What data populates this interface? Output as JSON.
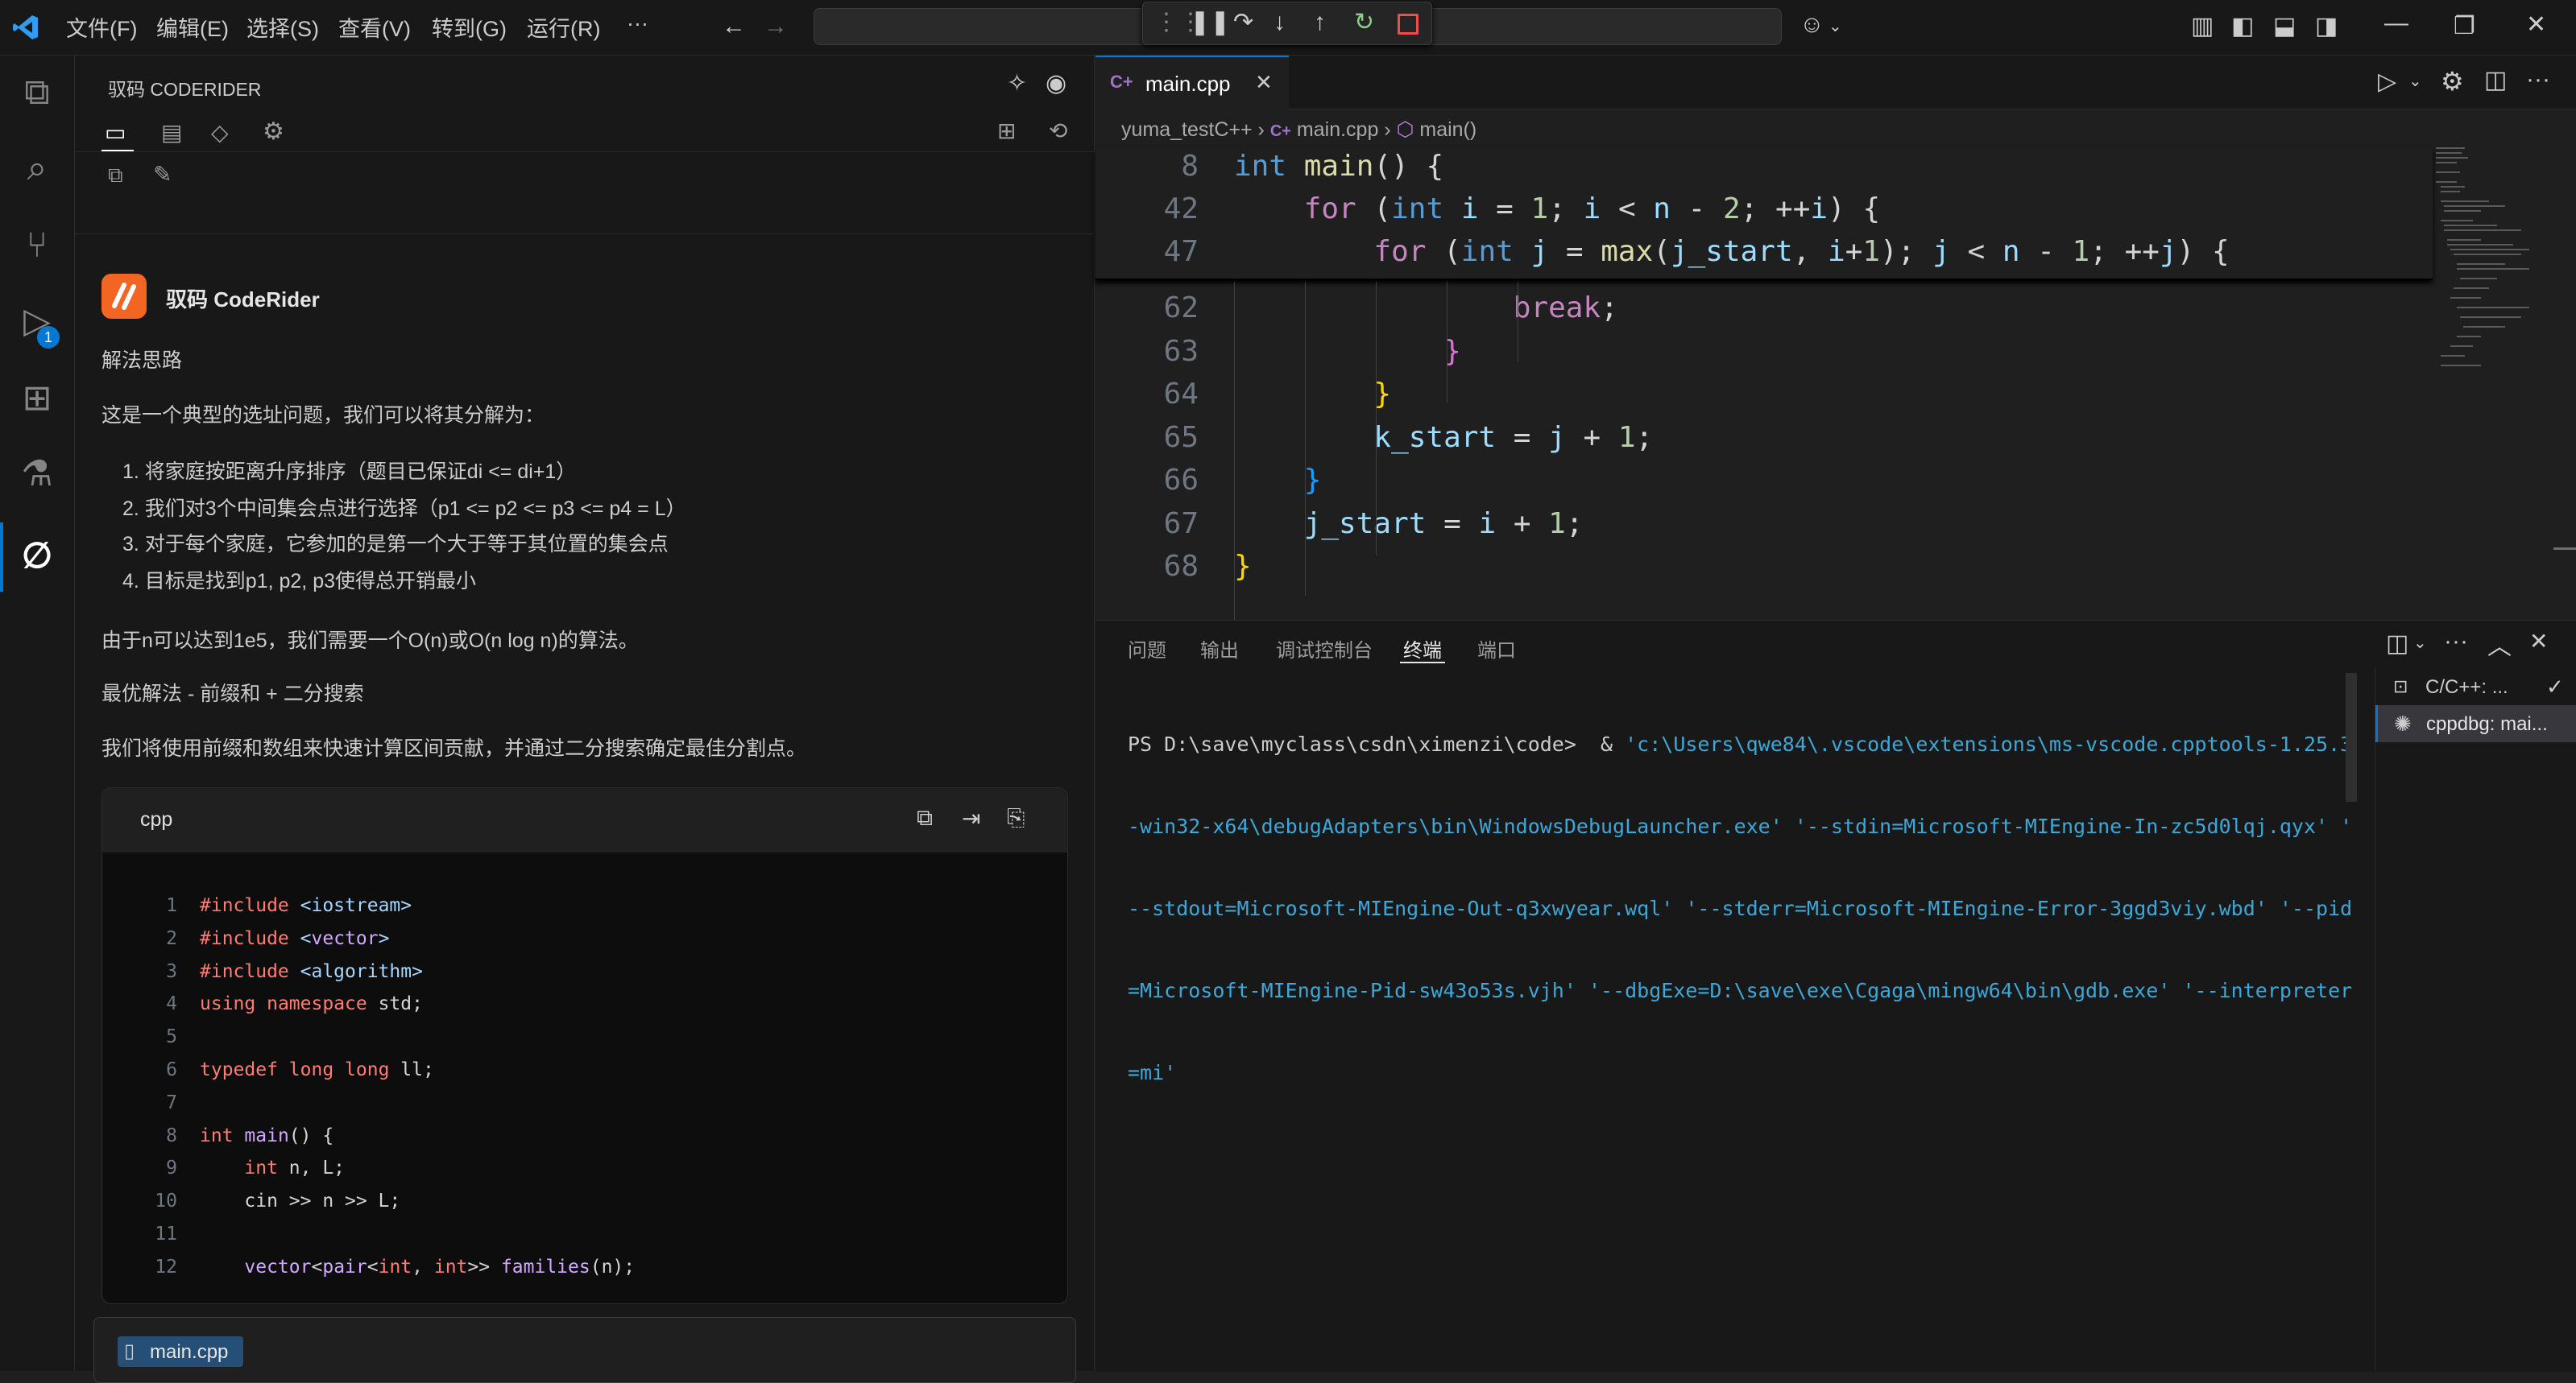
{
  "menu": [
    "文件(F)",
    "编辑(E)",
    "选择(S)",
    "查看(V)",
    "转到(G)",
    "运行(R)",
    "···"
  ],
  "activity": {
    "debug_badge": "1"
  },
  "sidebar": {
    "title": "驭码 CODERIDER",
    "bot_name": "驭码 CodeRider",
    "heading1": "解法思路",
    "intro": "这是一个典型的选址问题，我们可以将其分解为：",
    "steps": [
      "1. 将家庭按距离升序排序（题目已保证di <= di+1）",
      "2. 我们对3个中间集会点进行选择（p1 <= p2 <= p3 <= p4 = L）",
      "3. 对于每个家庭，它参加的是第一个大于等于其位置的集会点",
      "4. 目标是找到p1, p2, p3使得总开销最小"
    ],
    "note": "由于n可以达到1e5，我们需要一个O(n)或O(n log n)的算法。",
    "heading2": "最优解法 - 前缀和 + 二分搜索",
    "desc": "我们将使用前缀和数组来快速计算区间贡献，并通过二分搜索确定最佳分割点。",
    "code_lang": "cpp",
    "code_lines": [
      {
        "n": "1",
        "t": "#include <iostream>"
      },
      {
        "n": "2",
        "t": "#include <vector>"
      },
      {
        "n": "3",
        "t": "#include <algorithm>"
      },
      {
        "n": "4",
        "t": "using namespace std;"
      },
      {
        "n": "5",
        "t": ""
      },
      {
        "n": "6",
        "t": "typedef long long ll;"
      },
      {
        "n": "7",
        "t": ""
      },
      {
        "n": "8",
        "t": "int main() {"
      },
      {
        "n": "9",
        "t": "    int n, L;"
      },
      {
        "n": "10",
        "t": "    cin >> n >> L;"
      },
      {
        "n": "11",
        "t": ""
      },
      {
        "n": "12",
        "t": "    vector<pair<int, int>> families(n);"
      }
    ],
    "attached_file": "main.cpp"
  },
  "editor": {
    "tab": "main.cpp",
    "breadcrumb": [
      "yuma_testC++",
      "main.cpp",
      "main()"
    ],
    "sticky_lines": [
      {
        "n": "8",
        "t": "int main() {"
      },
      {
        "n": "42",
        "t": "    for (int i = 1; i < n - 2; ++i) {"
      },
      {
        "n": "47",
        "t": "        for (int j = max(j_start, i+1); j < n - 1; ++j) {"
      }
    ],
    "lines": [
      {
        "n": "62",
        "t": "                break;"
      },
      {
        "n": "63",
        "t": "            }"
      },
      {
        "n": "64",
        "t": "        }"
      },
      {
        "n": "65",
        "t": "        k_start = j + 1;"
      },
      {
        "n": "66",
        "t": "    }"
      },
      {
        "n": "67",
        "t": "    j_start = i + 1;"
      },
      {
        "n": "68",
        "t": "}"
      }
    ]
  },
  "panel": {
    "tabs": [
      "问题",
      "输出",
      "调试控制台",
      "终端",
      "端口"
    ],
    "active_tab": "终端",
    "terminal_prompt": "PS D:\\save\\myclass\\csdn\\ximenzi\\code>  & ",
    "terminal_lines": [
      "'c:\\Users\\qwe84\\.vscode\\extensions\\ms-vscode.cpptools-1.25.3",
      "-win32-x64\\debugAdapters\\bin\\WindowsDebugLauncher.exe' '--stdin=Microsoft-MIEngine-In-zc5d0lqj.qyx' '",
      "--stdout=Microsoft-MIEngine-Out-q3xwyear.wql' '--stderr=Microsoft-MIEngine-Error-3ggd3viy.wbd' '--pid",
      "=Microsoft-MIEngine-Pid-sw43o53s.vjh' '--dbgExe=D:\\save\\exe\\Cgaga\\mingw64\\bin\\gdb.exe' '--interpreter",
      "=mi'"
    ],
    "terminal_list": [
      "C/C++: ...",
      "cppdbg: mai..."
    ]
  },
  "colors": {
    "accent": "#0078d4",
    "logo_orange": "#f26522"
  }
}
